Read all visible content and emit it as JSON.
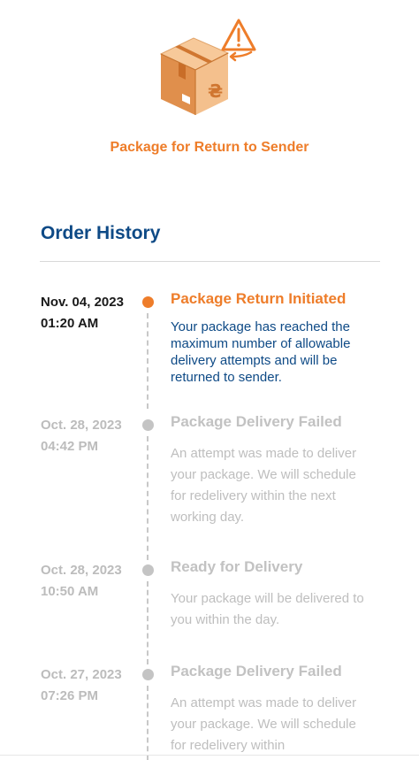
{
  "shipment": {
    "status_label": "Package for Return to Sender",
    "status_color": "#ee7d2a"
  },
  "history": {
    "title": "Order History",
    "title_color": "#0e4a86",
    "events": [
      {
        "date": "Nov. 04, 2023 01:20 AM",
        "title": "Package Return Initiated",
        "description": "Your package has reached the maximum number of allowable delivery attempts and will be returned to sender.",
        "status": "current"
      },
      {
        "date": "Oct. 28, 2023 04:42 PM",
        "title": "Package Delivery Failed",
        "description": "An attempt was made to deliver your package. We will schedule for redelivery within the next working day.",
        "status": "past"
      },
      {
        "date": "Oct. 28, 2023 10:50 AM",
        "title": "Ready for Delivery",
        "description": "Your package will be delivered to you within the day.",
        "status": "past"
      },
      {
        "date": "Oct. 27, 2023 07:26 PM",
        "title": "Package Delivery Failed",
        "description": "An attempt was made to deliver your package. We will schedule for redelivery within",
        "status": "past"
      }
    ]
  },
  "icons": {
    "hero": "package-box-icon",
    "warning": "warning-triangle-icon",
    "return_arrow": "return-arrow-icon"
  }
}
